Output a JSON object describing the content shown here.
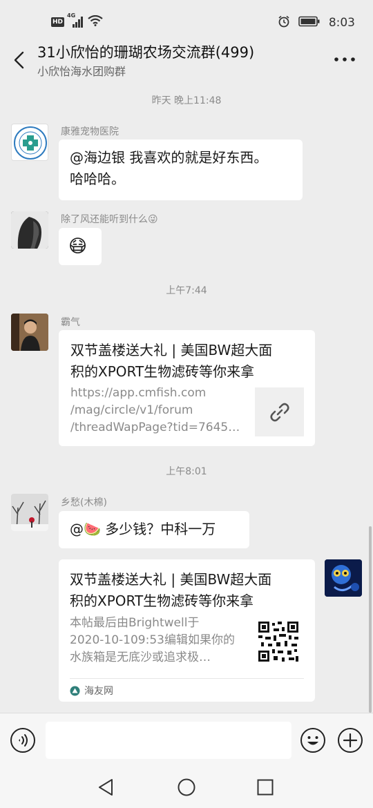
{
  "status_bar": {
    "hd_label": "HD",
    "network_label": "4G",
    "time": "8:03"
  },
  "header": {
    "title": "31小欣怡的珊瑚农场交流群(499)",
    "subtitle": "小欣怡海水团购群"
  },
  "messages": {
    "ts1": "昨天 晚上11:48",
    "m1_sender": "康雅宠物医院",
    "m1_line1": "@海边银  我喜欢的就是好东西。",
    "m1_line2": "哈哈哈。",
    "m2_sender": "除了风还能听到什么😜",
    "m2_text": "😷",
    "ts2": "上午7:44",
    "m3_sender": "霸气",
    "m3_title1": "双节盖楼送大礼 | 美国BW超大面",
    "m3_title2": "积的XPORT生物滤砖等你来拿",
    "m3_url1": "https://app.cmfish.com",
    "m3_url2": "/mag/circle/v1/forum",
    "m3_url3": "/threadWapPage?tid=7645…",
    "ts3": "上午8:01",
    "m4_sender": "乡愁(木棉)",
    "m4_text": "@🍉  多少钱？中科一万",
    "m5_title1": "双节盖楼送大礼 | 美国BW超大面",
    "m5_title2": "积的XPORT生物滤砖等你来拿",
    "m5_desc1": "本帖最后由Brightwell于",
    "m5_desc2": "2020-10-109:53编辑如果你的",
    "m5_desc3": "水族箱是无底沙或追求极…",
    "m5_source": "海友网"
  },
  "input": {
    "placeholder": ""
  },
  "icons": {
    "back": "back-arrow-icon",
    "more": "more-dots-icon",
    "link": "link-icon",
    "voice": "voice-icon",
    "emoji": "emoji-icon",
    "plus": "plus-icon"
  },
  "colors": {
    "background": "#ededed",
    "bubble": "#ffffff",
    "timestamp": "#8a8a8a"
  }
}
